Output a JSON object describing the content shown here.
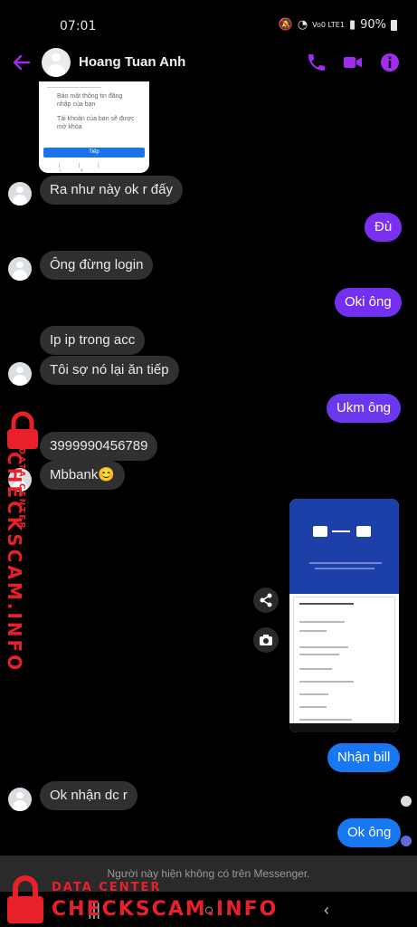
{
  "status": {
    "time": "07:01",
    "network": "Vo0 LTE1",
    "battery": "90%"
  },
  "header": {
    "contact_name": "Hoang Tuan Anh"
  },
  "shared_screenshot": {
    "lines": [
      "Bảo mật thông tin đăng",
      "nhập của bạn",
      "Tài khoản của bạn sẽ được",
      "mở khóa"
    ],
    "button": "Tiếp"
  },
  "messages": [
    {
      "side": "in",
      "text": "Ra như này ok r đấy"
    },
    {
      "side": "out",
      "text": "Đù"
    },
    {
      "side": "in",
      "text": "Ông đừng login"
    },
    {
      "side": "out",
      "text": "Oki ông"
    },
    {
      "side": "in",
      "text": "Ip ip trong acc"
    },
    {
      "side": "in",
      "text": "Tôi sợ nó lại ăn tiếp"
    },
    {
      "side": "out",
      "text": "Ukm ông"
    },
    {
      "side": "in",
      "text": "3999990456789"
    },
    {
      "side": "in",
      "text": "Mbbank😊"
    },
    {
      "side": "out",
      "text": "Nhận bill"
    },
    {
      "side": "in",
      "text": "Ok nhận dc r"
    },
    {
      "side": "out",
      "text": "Ok ông"
    }
  ],
  "footer": {
    "notice": "Người này hiện không có trên Messenger."
  },
  "watermark": {
    "small": "DATA CENTER",
    "large": "CHECKSCAM.INFO"
  },
  "colors": {
    "accent": "#8a2be2",
    "outgoing_purple": "#7b2ff0",
    "outgoing_blue": "#1877f2",
    "incoming": "#303030",
    "watermark": "#e8202a"
  },
  "icons": [
    "back-arrow-icon",
    "phone-icon",
    "video-camera-icon",
    "info-icon",
    "share-icon",
    "camera-icon"
  ]
}
